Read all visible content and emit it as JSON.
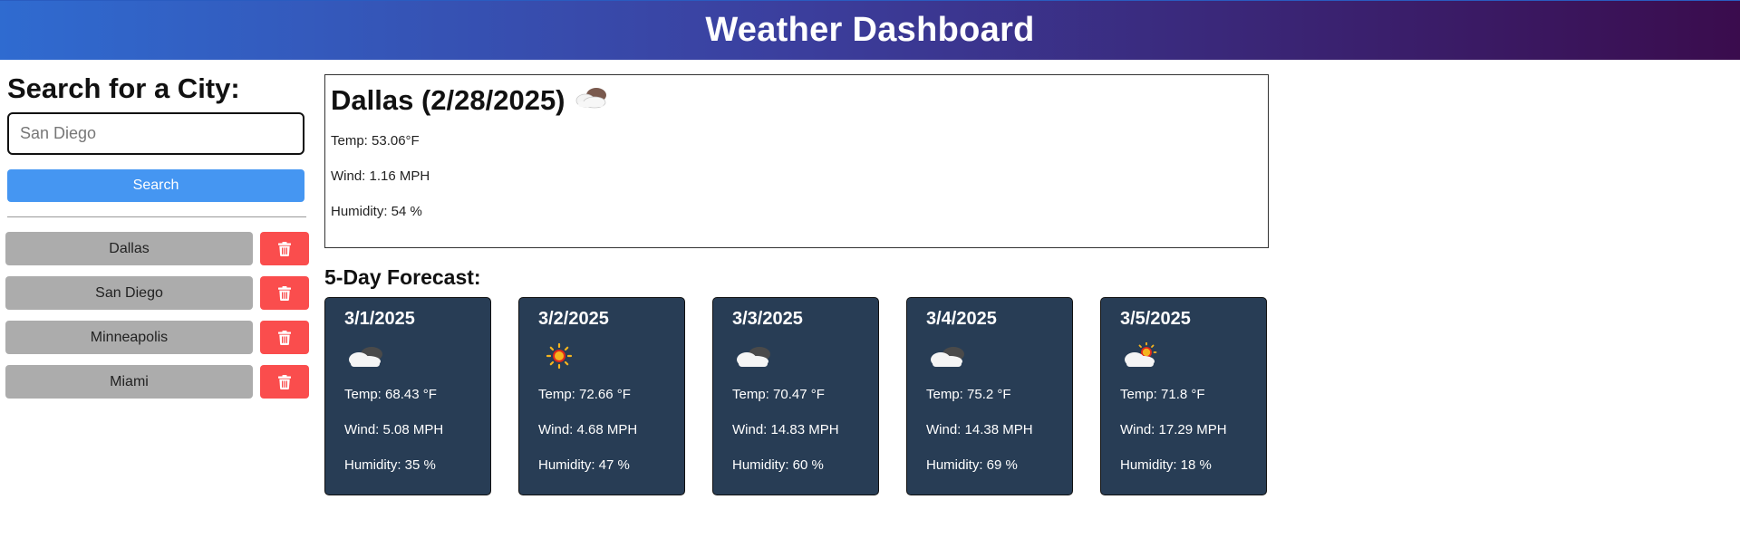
{
  "header": {
    "title": "Weather Dashboard"
  },
  "search": {
    "heading": "Search for a City:",
    "input_value": "San Diego",
    "input_placeholder": "San Diego",
    "button_label": "Search"
  },
  "history": [
    {
      "city": "Dallas",
      "delete_icon": "trash-icon"
    },
    {
      "city": "San Diego",
      "delete_icon": "trash-icon"
    },
    {
      "city": "Minneapolis",
      "delete_icon": "trash-icon"
    },
    {
      "city": "Miami",
      "delete_icon": "trash-icon"
    }
  ],
  "current": {
    "title": "Dallas (2/28/2025)",
    "icon": "broken-clouds-icon",
    "temp": "Temp: 53.06°F",
    "wind": "Wind: 1.16 MPH",
    "humidity": "Humidity: 54 %"
  },
  "forecast": {
    "heading": "5-Day Forecast:",
    "days": [
      {
        "date": "3/1/2025",
        "icon": "broken-clouds-icon",
        "temp": "Temp: 68.43 °F",
        "wind": "Wind: 5.08 MPH",
        "humidity": "Humidity: 35 %"
      },
      {
        "date": "3/2/2025",
        "icon": "clear-sun-icon",
        "temp": "Temp: 72.66 °F",
        "wind": "Wind: 4.68 MPH",
        "humidity": "Humidity: 47 %"
      },
      {
        "date": "3/3/2025",
        "icon": "broken-clouds-icon",
        "temp": "Temp: 70.47 °F",
        "wind": "Wind: 14.83 MPH",
        "humidity": "Humidity: 60 %"
      },
      {
        "date": "3/4/2025",
        "icon": "broken-clouds-icon",
        "temp": "Temp: 75.2 °F",
        "wind": "Wind: 14.38 MPH",
        "humidity": "Humidity: 69 %"
      },
      {
        "date": "3/5/2025",
        "icon": "few-clouds-icon",
        "temp": "Temp: 71.8 °F",
        "wind": "Wind: 17.29 MPH",
        "humidity": "Humidity: 18 %"
      }
    ]
  },
  "colors": {
    "header_start": "#2f6bd0",
    "header_end": "#3a0c4d",
    "search_button": "#4596f2",
    "history_button": "#acacac",
    "delete_button": "#fa4d4d",
    "card_background": "#283d55"
  }
}
